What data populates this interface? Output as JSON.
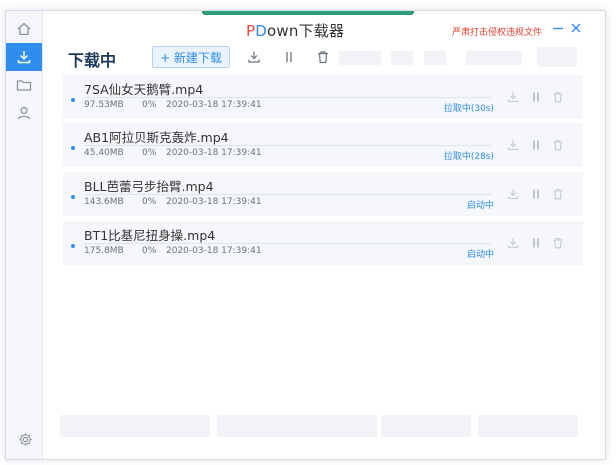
{
  "app": {
    "title_p": "P",
    "title_d": "D",
    "title_rest": "own下载器",
    "notice": "严肃打击侵权违规文件"
  },
  "header": {
    "title": "下载中",
    "new_download_label": "+ 新建下载"
  },
  "colors": {
    "accent": "#2e8ded",
    "notice": "#e0412f",
    "topbar": "#2d9b78"
  },
  "downloads": [
    {
      "name": "7SA仙女天鹅臂.mp4",
      "size": "97.53MB",
      "percent": "0%",
      "progress": 0,
      "time": "2020-03-18 17:39:41",
      "status": "拉取中(30s)"
    },
    {
      "name": "AB1阿拉贝斯克轰炸.mp4",
      "size": "45.40MB",
      "percent": "0%",
      "progress": 0,
      "time": "2020-03-18 17:39:41",
      "status": "拉取中(28s)"
    },
    {
      "name": "BLL芭蕾弓步抬臂.mp4",
      "size": "143.6MB",
      "percent": "0%",
      "progress": 0,
      "time": "2020-03-18 17:39:41",
      "status": "启动中"
    },
    {
      "name": "BT1比基尼扭身操.mp4",
      "size": "175.8MB",
      "percent": "0%",
      "progress": 0,
      "time": "2020-03-18 17:39:41",
      "status": "启动中"
    }
  ],
  "icons": {
    "sidebar": [
      "home-icon",
      "download-icon",
      "folder-icon",
      "user-icon"
    ],
    "settings": "gear-icon",
    "toolbar": [
      "download-icon",
      "pause-icon",
      "trash-icon"
    ]
  }
}
